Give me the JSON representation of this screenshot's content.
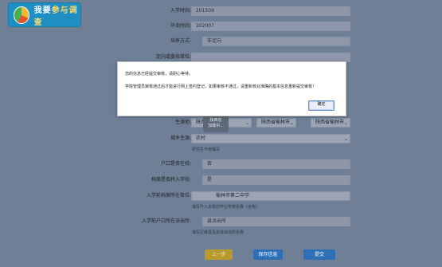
{
  "logo": {
    "text_a": "我要",
    "text_b": "参与调查"
  },
  "form": {
    "entry_time": {
      "label": "入学时间:",
      "value": "201509"
    },
    "grad_time": {
      "label": "毕业时间:",
      "value": "202007"
    },
    "training": {
      "label": "培养方式:",
      "value": "非定向"
    },
    "unit": {
      "label": "定向或委培单位:"
    },
    "origin": {
      "label": "生源地:",
      "prov": "陕西省",
      "city": "陕西省榆林市",
      "county": "陕西省榆林市"
    },
    "urban_rural": {
      "label": "城乡生源:",
      "value": "农村",
      "hint": "研究生不用填写"
    },
    "hukou_transfer": {
      "label": "户口是否在校:",
      "value": "否"
    },
    "transfer_student": {
      "label": "档案是否转入学校:",
      "value": "是"
    },
    "archive_unit": {
      "label": "入学前档案所在单位:",
      "value": "榆林市第二中学",
      "hint": "填写升入本校前毕业学校名称（全称）"
    },
    "hukou_place": {
      "label": "入学前户口所在派出所:",
      "placeholder": "县派出所",
      "hint": "填写区或县及具体派出所名称"
    }
  },
  "loading": {
    "line1": "陕西省",
    "line2": "加载中..."
  },
  "dialog": {
    "line1": "您的信息已经提交审核，请耐心等待。",
    "line2": "学院管理员审核通过后才能进行网上签约登记，如果审核不通过，请重新核对准确的基本信息重新提交审核！",
    "ok": "确定"
  },
  "buttons": {
    "prev": "上一步",
    "save": "保存信息",
    "submit": "提交"
  }
}
